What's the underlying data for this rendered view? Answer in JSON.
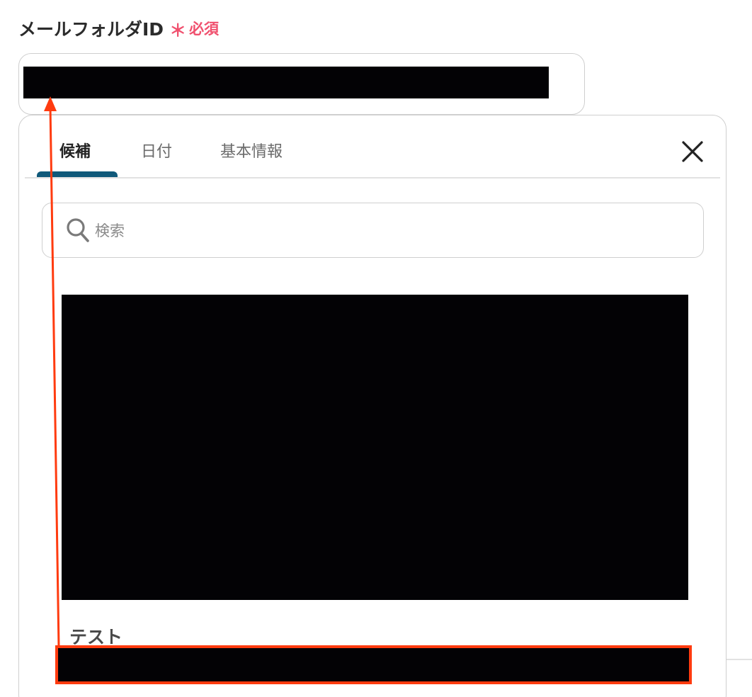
{
  "field": {
    "label": "メールフォルダID",
    "required_mark": "＊",
    "required_text": "必須"
  },
  "tabs": [
    {
      "label": "候補",
      "active": true
    },
    {
      "label": "日付",
      "active": false
    },
    {
      "label": "基本情報",
      "active": false
    }
  ],
  "search": {
    "placeholder": "検索",
    "value": ""
  },
  "section": {
    "label": "テスト"
  },
  "icons": {
    "close": "close-icon",
    "search": "search-icon"
  },
  "colors": {
    "required": "#f0506e",
    "tab_indicator": "#10597a",
    "annotation": "#ff3b0f"
  }
}
